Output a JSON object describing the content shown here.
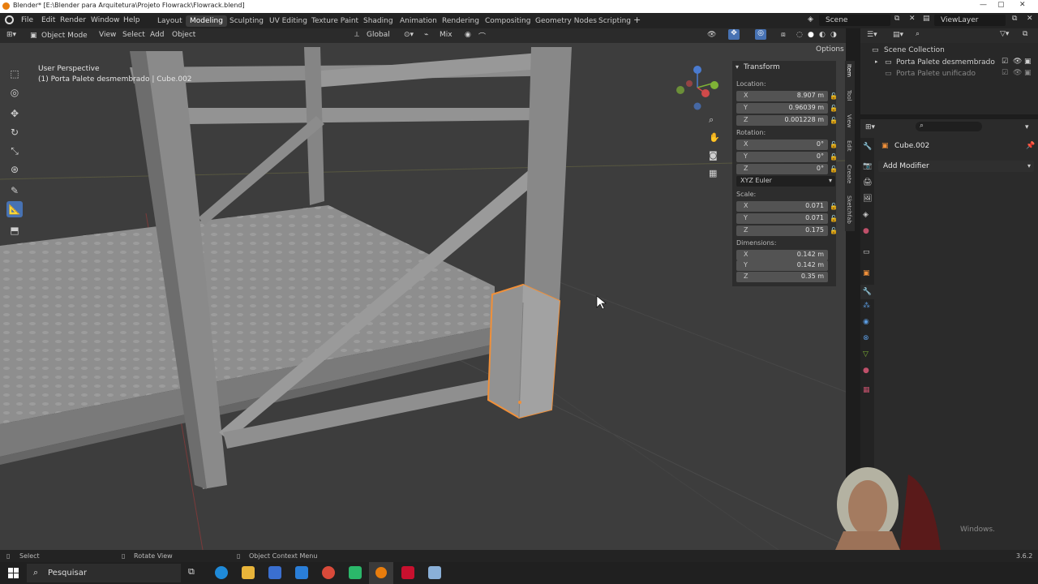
{
  "window": {
    "title": "Blender* [E:\\Blender para Arquitetura\\Projeto Flowrack\\Flowrack.blend]"
  },
  "menu": {
    "file": "File",
    "edit": "Edit",
    "render": "Render",
    "window": "Window",
    "help": "Help"
  },
  "workspaces": [
    "Layout",
    "Modeling",
    "Sculpting",
    "UV Editing",
    "Texture Paint",
    "Shading",
    "Animation",
    "Rendering",
    "Compositing",
    "Geometry Nodes",
    "Scripting"
  ],
  "active_workspace": "Modeling",
  "scene": {
    "label": "Scene",
    "view_layer": "ViewLayer"
  },
  "header": {
    "mode": "Object Mode",
    "view": "View",
    "select": "Select",
    "add": "Add",
    "object": "Object",
    "orientation": "Global",
    "mix": "Mix",
    "options": "Options"
  },
  "viewport": {
    "perspective": "User Perspective",
    "context": "(1) Porta Palete desmembrado | Cube.002"
  },
  "transform": {
    "title": "Transform",
    "location_label": "Location:",
    "location": {
      "x": "8.907 m",
      "y": "0.96039 m",
      "z": "0.001228 m"
    },
    "rotation_label": "Rotation:",
    "rotation": {
      "x": "0°",
      "y": "0°",
      "z": "0°"
    },
    "rotation_mode": "XYZ Euler",
    "scale_label": "Scale:",
    "scale": {
      "x": "0.071",
      "y": "0.071",
      "z": "0.175"
    },
    "dimensions_label": "Dimensions:",
    "dimensions": {
      "x": "0.142 m",
      "y": "0.142 m",
      "z": "0.35 m"
    },
    "axes": {
      "x": "X",
      "y": "Y",
      "z": "Z"
    }
  },
  "side_tabs": [
    "Item",
    "Tool",
    "View",
    "Edit",
    "Create",
    "Sketchfab"
  ],
  "outliner": {
    "root": "Scene Collection",
    "items": [
      "Porta Palete desmembrado",
      "Porta Palete unificado"
    ]
  },
  "properties": {
    "object": "Cube.002",
    "add_modifier": "Add Modifier"
  },
  "status": {
    "select": "Select",
    "rotate": "Rotate View",
    "context_menu": "Object Context Menu",
    "version": "3.6.2"
  },
  "taskbar": {
    "search": "Pesquisar"
  },
  "watermark": "Windows.",
  "colors": {
    "accent": "#4772b3",
    "selection": "#f0903a",
    "viewport": "#3d3d3d"
  }
}
